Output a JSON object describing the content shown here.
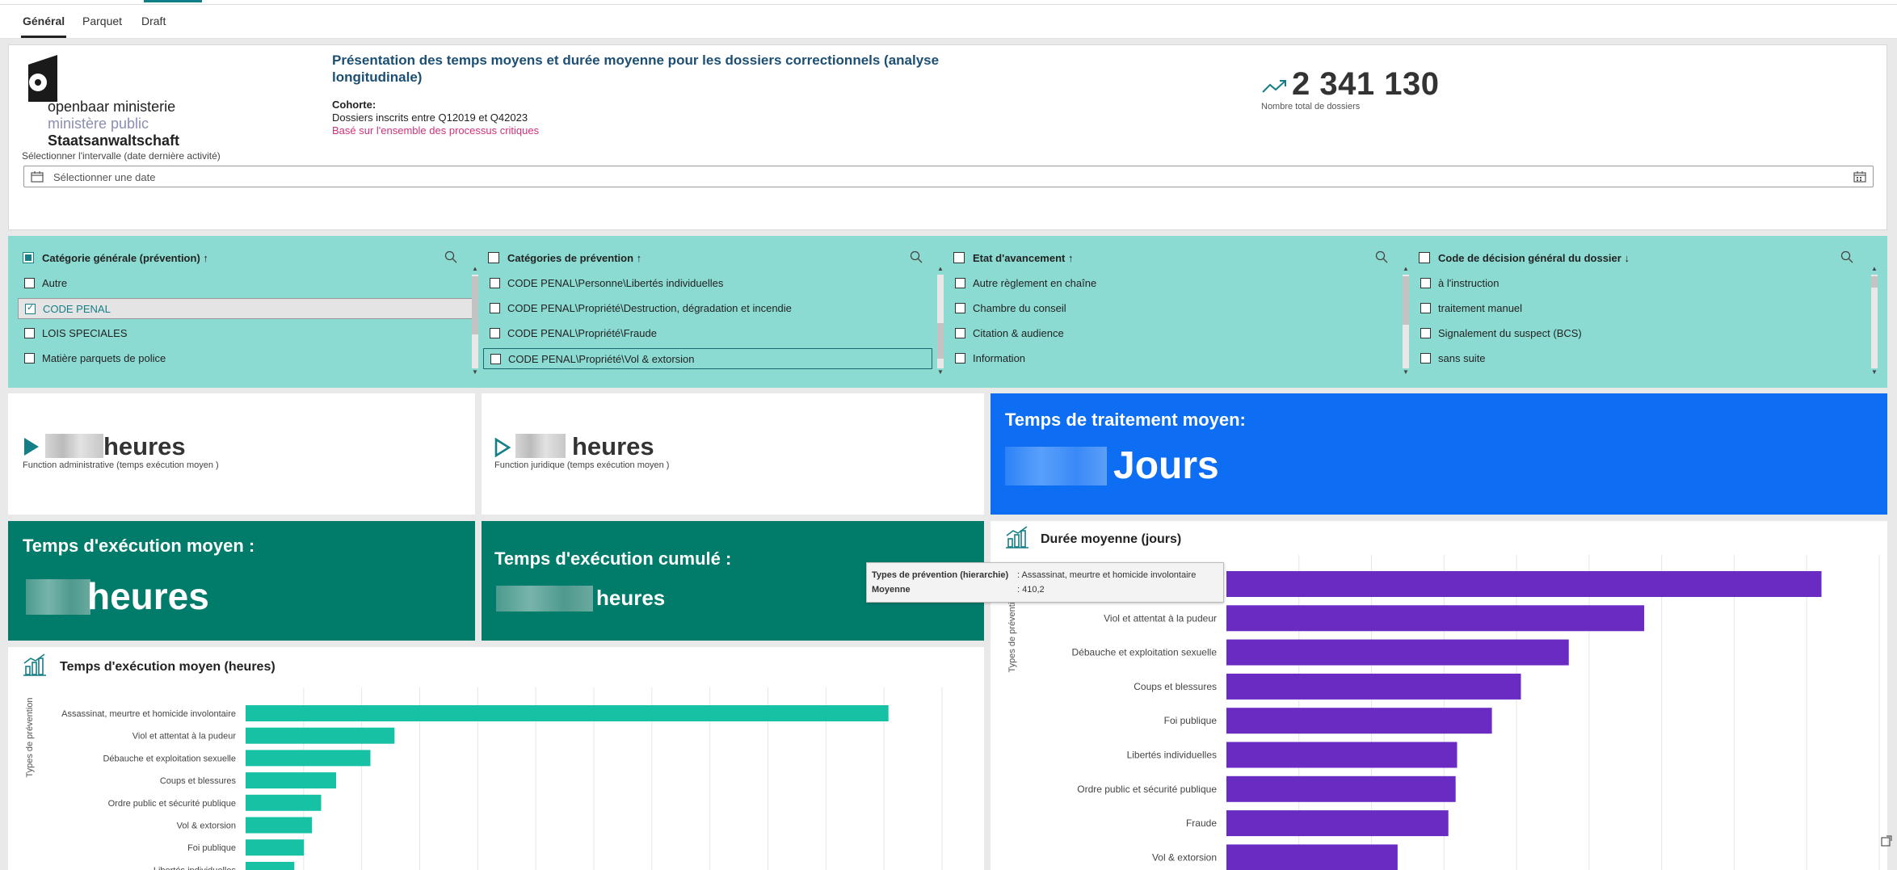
{
  "tabs": [
    {
      "label": "Général",
      "active": true
    },
    {
      "label": "Parquet",
      "active": false
    },
    {
      "label": "Draft",
      "active": false
    }
  ],
  "logo": {
    "line1": "openbaar ministerie",
    "line2": "ministère public",
    "line3": "Staatsanwaltschaft"
  },
  "header": {
    "title": "Présentation des temps moyens et durée moyenne pour les dossiers correctionnels (analyse longitudinale)",
    "cohort_label": "Cohorte:",
    "cohort_text": "Dossiers inscrits entre Q12019  et Q42023",
    "cohort_note": "Basé sur l'ensemble des processus critiques",
    "total_value": "2 341 130",
    "total_label": "Nombre total de dossiers",
    "interval_label": "Sélectionner l'intervalle (date dernière activité)",
    "date_placeholder": "Sélectionner une date"
  },
  "filters": [
    {
      "title": "Catégorie générale (prévention)",
      "sort": "↑",
      "header_checked": true,
      "items": [
        {
          "label": "Autre",
          "checked": false
        },
        {
          "label": "CODE PENAL",
          "checked": true
        },
        {
          "label": "LOIS SPECIALES",
          "checked": false
        },
        {
          "label": "Matière parquets de police",
          "checked": false
        }
      ]
    },
    {
      "title": "Catégories de prévention",
      "sort": "↑",
      "header_checked": false,
      "items": [
        {
          "label": "CODE PENAL\\Personne\\Libertés individuelles",
          "checked": false
        },
        {
          "label": "CODE PENAL\\Propriété\\Destruction, dégradation et incendie",
          "checked": false
        },
        {
          "label": "CODE PENAL\\Propriété\\Fraude",
          "checked": false
        },
        {
          "label": "CODE PENAL\\Propriété\\Vol & extorsion",
          "checked": false
        }
      ]
    },
    {
      "title": "Etat d'avancement",
      "sort": "↑",
      "header_checked": false,
      "items": [
        {
          "label": "Autre règlement en chaîne",
          "checked": false
        },
        {
          "label": "Chambre du conseil",
          "checked": false
        },
        {
          "label": "Citation & audience",
          "checked": false
        },
        {
          "label": "Information",
          "checked": false
        }
      ]
    },
    {
      "title": "Code de décision général du dossier",
      "sort": "↓",
      "header_checked": false,
      "items": [
        {
          "label": "à l'instruction",
          "checked": false
        },
        {
          "label": "traitement manuel",
          "checked": false
        },
        {
          "label": "Signalement du suspect (BCS)",
          "checked": false
        },
        {
          "label": "sans suite",
          "checked": false
        }
      ]
    }
  ],
  "kpis": {
    "admin_unit": "heures",
    "admin_label": "Function administrative (temps exécution moyen )",
    "jur_unit": "heures",
    "jur_label": "Function juridique (temps exécution moyen )",
    "treat_title": "Temps de traitement moyen:",
    "treat_unit": "Jours",
    "exec_title": "Temps d'exécution moyen  :",
    "exec_unit": "heures",
    "cum_title": "Temps d'exécution cumulé :",
    "cum_unit": "heures"
  },
  "colors": {
    "teal_filter": "#8cdbd3",
    "green_card": "#017c6b",
    "blue_card": "#0d6ef3",
    "teal_bar": "#16c1a4",
    "purple_bar": "#6a2bc3"
  },
  "chart_data": [
    {
      "type": "bar",
      "orientation": "horizontal",
      "title": "Temps d'exécution moyen (heures)",
      "ylabel": "Types de prévention",
      "categories": [
        "Assassinat, meurtre et homicide involontaire",
        "Viol et attentat à la pudeur",
        "Débauche et exploitation sexuelle",
        "Coups et blessures",
        "Ordre public et sécurité publique",
        "Vol & extorsion",
        "Foi publique",
        "Libertés individuelles"
      ],
      "values": [
        120,
        27.8,
        23.3,
        16.9,
        14.1,
        12.4,
        10.9,
        9.1
      ],
      "xlim": [
        0,
        130
      ]
    },
    {
      "type": "bar",
      "orientation": "horizontal",
      "title": "Durée moyenne (jours)",
      "ylabel": "Types de prévention",
      "categories": [
        "Assassinat, meurtre et homicide involontaire",
        "Viol et attentat à la pudeur",
        "Débauche et exploitation sexuelle",
        "Coups et blessures",
        "Foi publique",
        "Libertés individuelles",
        "Ordre public et sécurité publique",
        "Fraude",
        "Vol & extorsion"
      ],
      "values": [
        410.2,
        288,
        236,
        203,
        183,
        159,
        158,
        153,
        118
      ],
      "xlim": [
        0,
        450
      ],
      "tooltip": {
        "key1": "Types de prévention (hierarchie)",
        "val1": ": Assassinat, meurtre et homicide involontaire",
        "key2": "Moyenne",
        "val2": ": 410,2"
      }
    }
  ]
}
